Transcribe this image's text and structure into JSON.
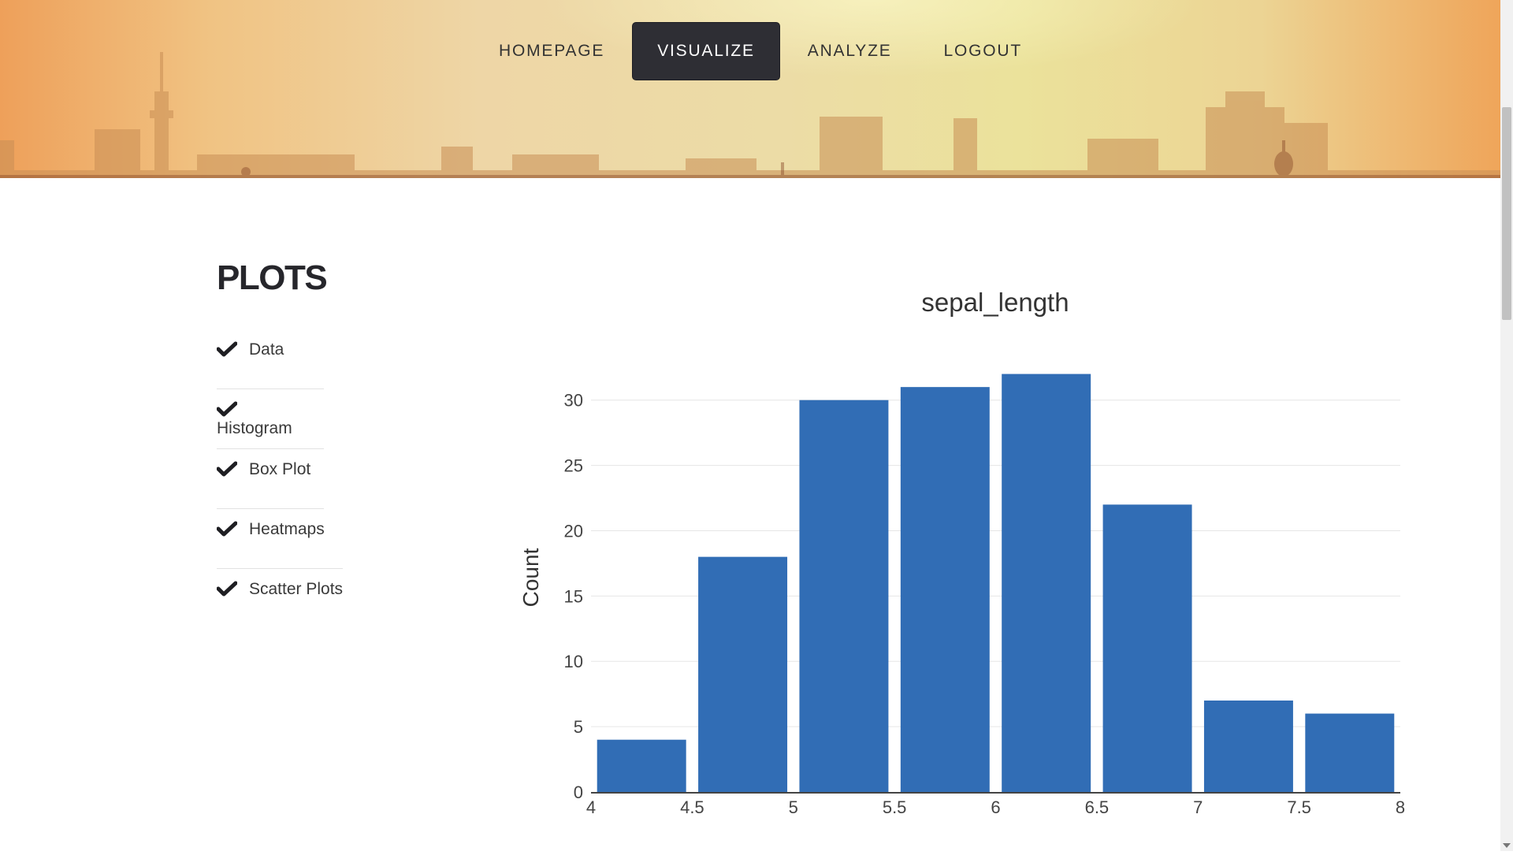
{
  "nav": {
    "items": [
      {
        "label": "HOMEPAGE",
        "active": false
      },
      {
        "label": "VISUALIZE",
        "active": true
      },
      {
        "label": "ANALYZE",
        "active": false
      },
      {
        "label": "LOGOUT",
        "active": false
      }
    ]
  },
  "sidebar": {
    "title": "PLOTS",
    "items": [
      {
        "label": "Data",
        "icon": "check-icon"
      },
      {
        "label": "Histogram",
        "icon": "check-icon"
      },
      {
        "label": "Box Plot",
        "icon": "check-icon"
      },
      {
        "label": "Heatmaps",
        "icon": "check-icon"
      },
      {
        "label": "Scatter Plots",
        "icon": "check-icon"
      }
    ]
  },
  "colors": {
    "bar": "#316db5",
    "nav_active_bg": "#2e2e34",
    "grid": "#e6e6e6"
  },
  "chart_data": {
    "type": "bar",
    "title": "sepal_length",
    "xlabel": "",
    "ylabel": "Count",
    "bins": [
      {
        "start": 4.0,
        "end": 4.5,
        "count": 4
      },
      {
        "start": 4.5,
        "end": 5.0,
        "count": 18
      },
      {
        "start": 5.0,
        "end": 5.5,
        "count": 30
      },
      {
        "start": 5.5,
        "end": 6.0,
        "count": 31
      },
      {
        "start": 6.0,
        "end": 6.5,
        "count": 32
      },
      {
        "start": 6.5,
        "end": 7.0,
        "count": 22
      },
      {
        "start": 7.0,
        "end": 7.5,
        "count": 7
      },
      {
        "start": 7.5,
        "end": 8.0,
        "count": 6
      }
    ],
    "xlim": [
      4,
      8
    ],
    "ylim": [
      0,
      33
    ],
    "x_ticks": [
      "4",
      "4.5",
      "5",
      "5.5",
      "6",
      "6.5",
      "7",
      "7.5",
      "8"
    ],
    "y_ticks": [
      "0",
      "5",
      "10",
      "15",
      "20",
      "25",
      "30"
    ],
    "grid": true,
    "legend": "none"
  }
}
